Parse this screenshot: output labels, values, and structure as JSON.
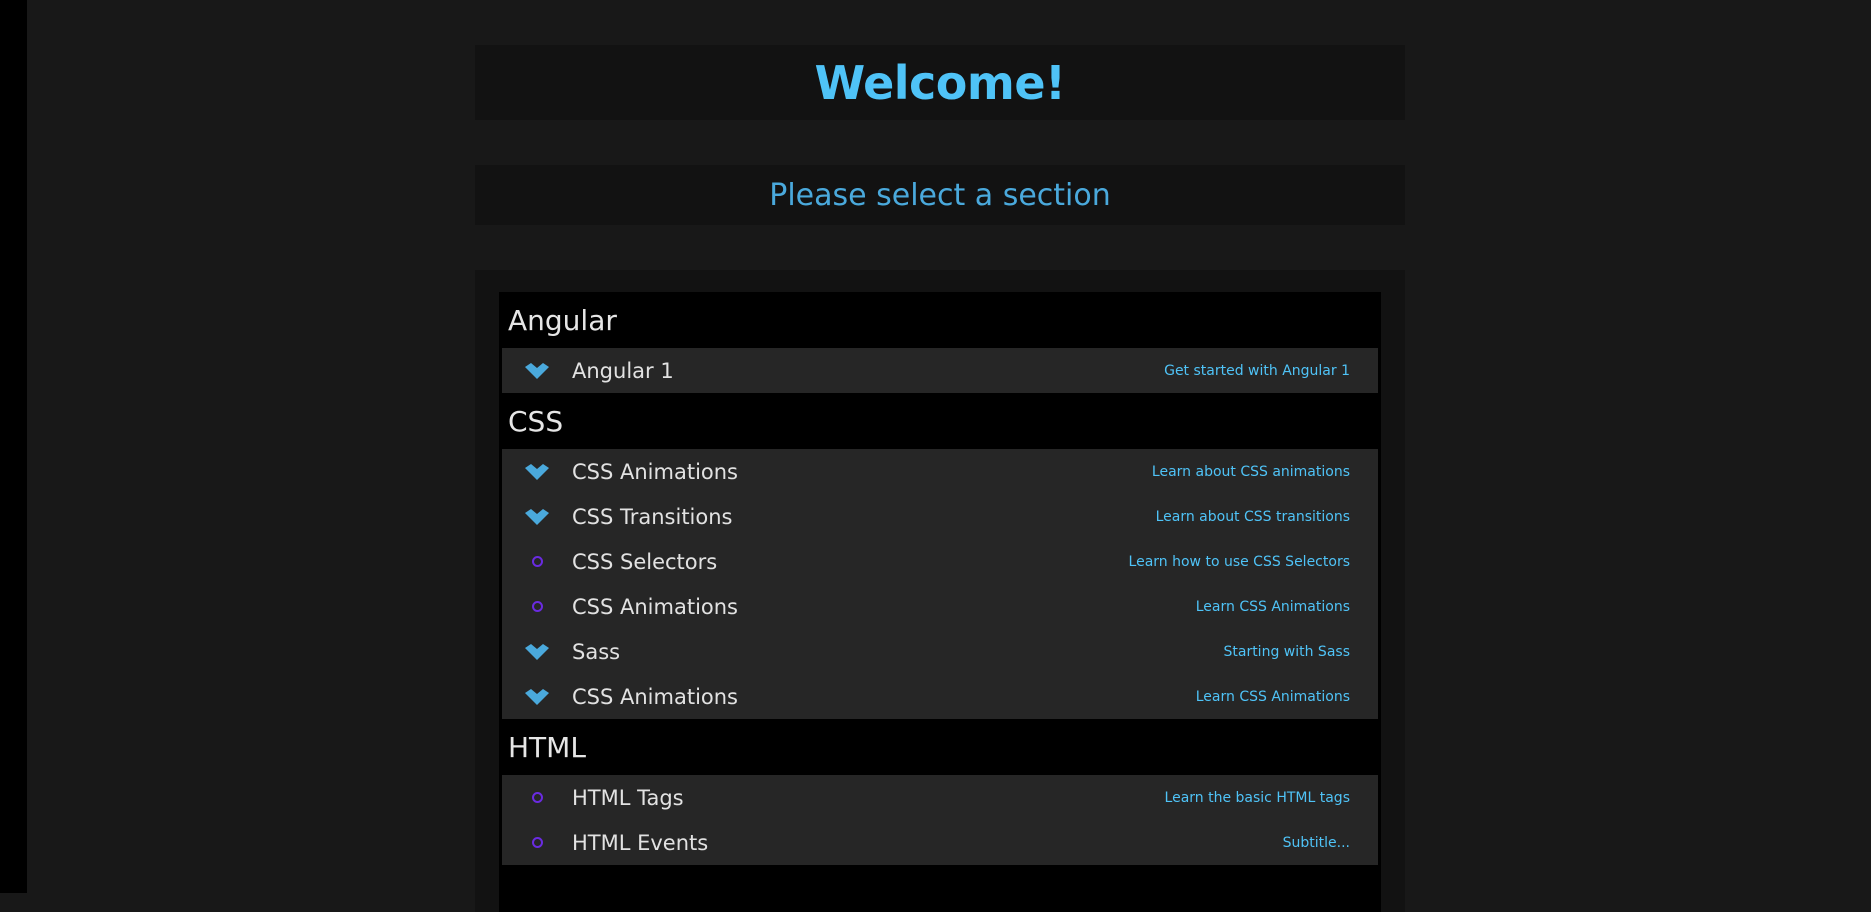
{
  "header": {
    "title": "Welcome!"
  },
  "subheader": {
    "text": "Please select a section"
  },
  "colors": {
    "accent": "#4fc3f7",
    "pending_circle": "#6a2be0",
    "check_icon": "#4aa9dc"
  },
  "groups": [
    {
      "name": "Angular",
      "items": [
        {
          "title": "Angular 1",
          "link": "Get started with Angular 1",
          "icon": "check-icon"
        }
      ]
    },
    {
      "name": "CSS",
      "items": [
        {
          "title": "CSS Animations",
          "link": "Learn about CSS animations",
          "icon": "check-icon"
        },
        {
          "title": "CSS Transitions",
          "link": "Learn about CSS transitions",
          "icon": "check-icon"
        },
        {
          "title": "CSS Selectors",
          "link": "Learn how to use CSS Selectors",
          "icon": "circle-icon"
        },
        {
          "title": "CSS Animations",
          "link": "Learn CSS Animations",
          "icon": "circle-icon"
        },
        {
          "title": "Sass",
          "link": "Starting with Sass",
          "icon": "check-icon"
        },
        {
          "title": "CSS Animations",
          "link": "Learn CSS Animations",
          "icon": "check-icon"
        }
      ]
    },
    {
      "name": "HTML",
      "items": [
        {
          "title": "HTML Tags",
          "link": "Learn the basic HTML tags",
          "icon": "circle-icon"
        },
        {
          "title": "HTML Events",
          "link": "Subtitle...",
          "icon": "circle-icon"
        }
      ]
    }
  ]
}
